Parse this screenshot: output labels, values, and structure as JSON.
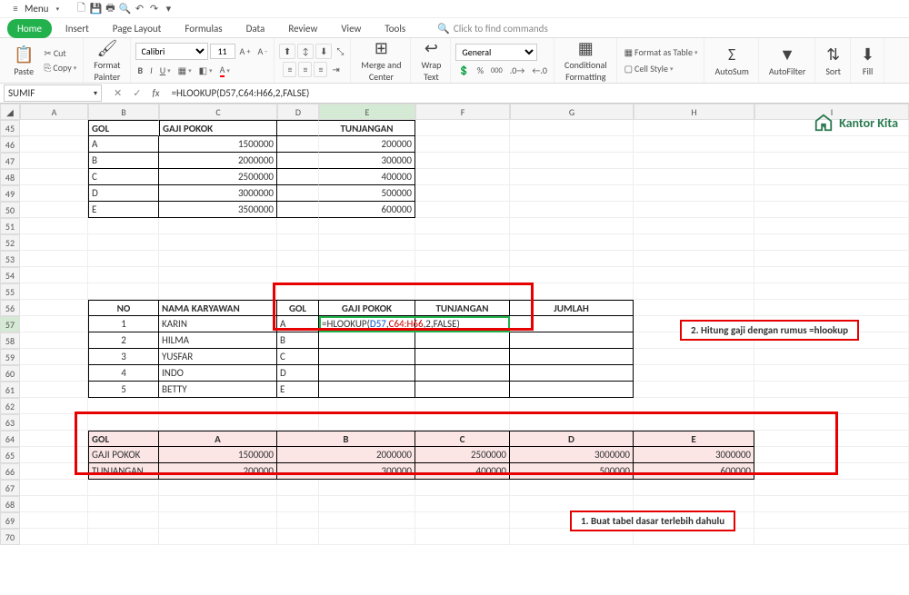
{
  "menu": {
    "label": "Menu"
  },
  "tabs": {
    "items": [
      "Home",
      "Insert",
      "Page Layout",
      "Formulas",
      "Data",
      "Review",
      "View",
      "Tools"
    ],
    "active": 0,
    "find_placeholder": "Click to find commands"
  },
  "ribbon": {
    "paste": "Paste",
    "cut": "Cut",
    "copy": "Copy",
    "format_painter": "Format\nPainter",
    "font": "Calibri",
    "size": "11",
    "merge": "Merge and\nCenter",
    "wrap": "Wrap\nText",
    "number_format": "General",
    "conditional": "Conditional\nFormatting",
    "format_table": "Format as Table",
    "cell_style": "Cell Style",
    "autosum": "AutoSum",
    "autofilter": "AutoFilter",
    "sort": "Sort",
    "fill": "Fill"
  },
  "fxbar": {
    "name": "SUMIF",
    "formula": "=HLOOKUP(D57,C64:H66,2,FALSE)"
  },
  "cols": [
    "A",
    "B",
    "C",
    "D",
    "E",
    "F",
    "G",
    "H",
    "I"
  ],
  "row_start": 45,
  "row_end": 70,
  "table1": {
    "head": {
      "gol": "GOL",
      "gaji": "GAJI POKOK",
      "tunj": "TUNJANGAN"
    },
    "rows": [
      {
        "gol": "A",
        "gaji": "1500000",
        "tunj": "200000"
      },
      {
        "gol": "B",
        "gaji": "2000000",
        "tunj": "300000"
      },
      {
        "gol": "C",
        "gaji": "2500000",
        "tunj": "400000"
      },
      {
        "gol": "D",
        "gaji": "3000000",
        "tunj": "500000"
      },
      {
        "gol": "E",
        "gaji": "3500000",
        "tunj": "600000"
      }
    ]
  },
  "table2": {
    "head": {
      "no": "NO",
      "nama": "NAMA KARYAWAN",
      "gol": "GOL",
      "gaji": "GAJI POKOK",
      "tunj": "TUNJANGAN",
      "jml": "JUMLAH"
    },
    "rows": [
      {
        "no": "1",
        "nama": "KARIN",
        "gol": "A"
      },
      {
        "no": "2",
        "nama": "HILMA",
        "gol": "B"
      },
      {
        "no": "3",
        "nama": "YUSFAR",
        "gol": "C"
      },
      {
        "no": "4",
        "nama": "INDO",
        "gol": "D"
      },
      {
        "no": "5",
        "nama": "BETTY",
        "gol": "E"
      }
    ],
    "formula_prefix": "=HLOOKUP(",
    "formula_tok1": " D57 ",
    "formula_sep1": ", ",
    "formula_tok2": "C64:H66 ",
    "formula_suffix": ",2,FALSE)"
  },
  "table3": {
    "labels": {
      "gol": "GOL",
      "gaji": "GAJI POKOK",
      "tunj": "TUNJANGAN"
    },
    "cols": [
      "A",
      "B",
      "C",
      "D",
      "E"
    ],
    "gaji": [
      "1500000",
      "2000000",
      "2500000",
      "3000000",
      "3000000"
    ],
    "tunj": [
      "200000",
      "300000",
      "400000",
      "500000",
      "600000"
    ]
  },
  "annot": {
    "step1": "1. Buat tabel dasar terlebih dahulu",
    "step2": "2. Hitung gaji dengan rumus =hlookup"
  },
  "logo": "Kantor Kita"
}
